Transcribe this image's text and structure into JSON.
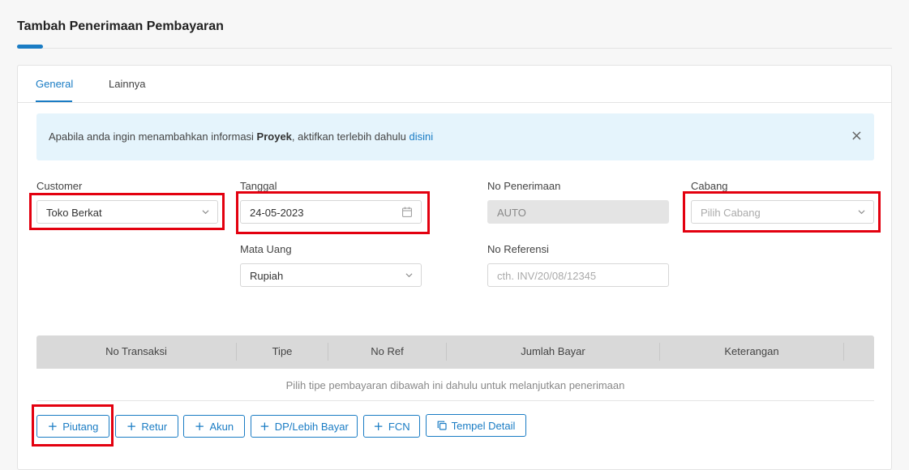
{
  "header": {
    "title": "Tambah Penerimaan Pembayaran"
  },
  "tabs": [
    {
      "label": "General",
      "active": true
    },
    {
      "label": "Lainnya",
      "active": false
    }
  ],
  "alert": {
    "text_before": "Apabila anda ingin menambahkan informasi ",
    "bold": "Proyek",
    "text_after": ", aktifkan terlebih dahulu ",
    "link": "disini",
    "close_icon": "close-icon"
  },
  "form": {
    "customer": {
      "label": "Customer",
      "value": "Toko Berkat"
    },
    "tanggal": {
      "label": "Tanggal",
      "value": "24-05-2023"
    },
    "no_penerimaan": {
      "label": "No Penerimaan",
      "value": "AUTO"
    },
    "cabang": {
      "label": "Cabang",
      "placeholder": "Pilih Cabang"
    },
    "mata_uang": {
      "label": "Mata Uang",
      "value": "Rupiah"
    },
    "no_referensi": {
      "label": "No Referensi",
      "placeholder": "cth. INV/20/08/12345"
    }
  },
  "table": {
    "columns": [
      "No Transaksi",
      "Tipe",
      "No Ref",
      "Jumlah Bayar",
      "Keterangan"
    ],
    "empty_message": "Pilih tipe pembayaran dibawah ini dahulu untuk melanjutkan penerimaan"
  },
  "buttons": {
    "piutang": "Piutang",
    "retur": "Retur",
    "akun": "Akun",
    "dp": "DP/Lebih Bayar",
    "fcn": "FCN",
    "tempel": "Tempel Detail"
  },
  "colors": {
    "accent": "#1a7cc4",
    "highlight": "#e3000f",
    "alert_bg": "#e5f4fc"
  }
}
